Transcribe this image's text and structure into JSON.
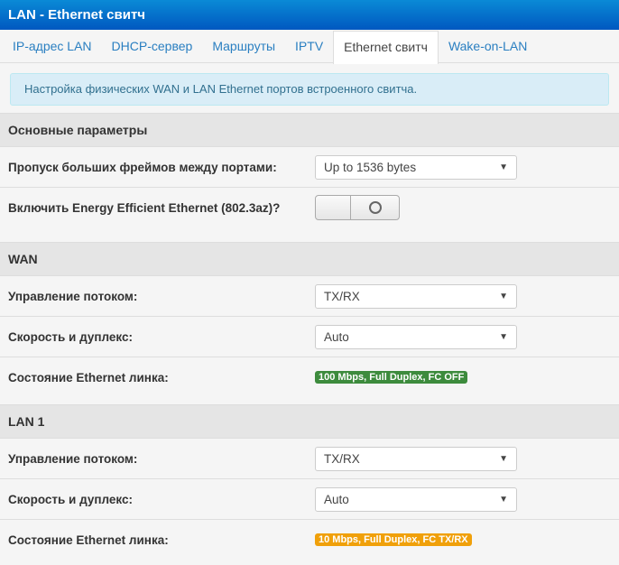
{
  "header": {
    "title": "LAN - Ethernet свитч"
  },
  "tabs": [
    {
      "label": "IP-адрес LAN"
    },
    {
      "label": "DHCP-сервер"
    },
    {
      "label": "Маршруты"
    },
    {
      "label": "IPTV"
    },
    {
      "label": "Ethernet свитч",
      "active": true
    },
    {
      "label": "Wake-on-LAN"
    }
  ],
  "info": "Настройка физических WAN и LAN Ethernet портов встроенного свитча.",
  "main": {
    "title": "Основные параметры",
    "jumbo_label": "Пропуск больших фреймов между портами:",
    "jumbo_value": "Up to 1536 bytes",
    "eee_label": "Включить Energy Efficient Ethernet (802.3az)?",
    "eee_on": false
  },
  "wan": {
    "title": "WAN",
    "flow_label": "Управление потоком:",
    "flow_value": "TX/RX",
    "speed_label": "Скорость и дуплекс:",
    "speed_value": "Auto",
    "link_label": "Состояние Ethernet линка:",
    "link_value": "100 Mbps, Full Duplex, FC OFF",
    "link_color": "#3d8b3d"
  },
  "lan1": {
    "title": "LAN 1",
    "flow_label": "Управление потоком:",
    "flow_value": "TX/RX",
    "speed_label": "Скорость и дуплекс:",
    "speed_value": "Auto",
    "link_label": "Состояние Ethernet линка:",
    "link_value": "10 Mbps, Full Duplex, FC TX/RX",
    "link_color": "#f0a00a"
  }
}
